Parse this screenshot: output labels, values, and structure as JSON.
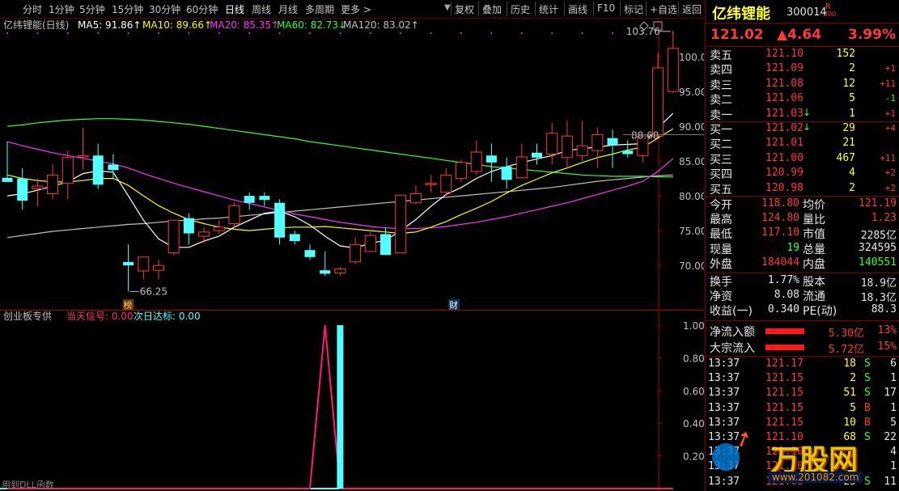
{
  "toolbar": {
    "periods": [
      "分时",
      "1分钟",
      "5分钟",
      "15分钟",
      "30分钟",
      "60分钟",
      "日线",
      "周线",
      "月线",
      "多周期",
      "更多 >"
    ],
    "actions": [
      "复权",
      "叠加",
      "历史",
      "统计",
      "画线",
      "F10",
      "标记",
      "+自选",
      "返回"
    ],
    "top_glyph": "▼"
  },
  "chart_header": {
    "name": "亿纬锂能(日线)",
    "ma5": "MA5: 91.86↑",
    "ma10": "MA10: 89.66↑",
    "ma20": "MA20: 85.35↑",
    "ma60": "MA60: 82.73↓",
    "ma120": "MA120: 83.02↑"
  },
  "colors": {
    "up": "#ff3a3a",
    "down": "#54ffff",
    "ma5": "#ffffff",
    "ma10": "#ffff00",
    "ma20": "#ff33ff",
    "ma60": "#33ff33",
    "ma120": "#c0c0c0",
    "axis": "#b00000"
  },
  "main_axis": {
    "ticks": [
      "100.0",
      "95.00",
      "90.00",
      "85.00",
      "80.00",
      "75.00",
      "70.00"
    ],
    "tick_values": [
      100,
      95,
      90,
      85,
      80,
      75,
      70
    ],
    "ylim": [
      63.5,
      105.6
    ]
  },
  "annotations": {
    "high_label": "103.76",
    "low_label": "66.25",
    "current_price_tag": "88.68",
    "bang_tag": "榜",
    "cai_tag": "财"
  },
  "chart_data": [
    {
      "type": "candlestick",
      "candles": [
        {
          "o": 82.6,
          "h": 87.8,
          "l": 82.3,
          "c": 82.0
        },
        {
          "o": 82.5,
          "h": 84.0,
          "l": 78.0,
          "c": 79.3
        },
        {
          "o": 81.0,
          "h": 82.5,
          "l": 78.5,
          "c": 81.4
        },
        {
          "o": 80.3,
          "h": 84.5,
          "l": 79.5,
          "c": 83.0
        },
        {
          "o": 81.8,
          "h": 86.5,
          "l": 79.5,
          "c": 85.5
        },
        {
          "o": 85.6,
          "h": 89.8,
          "l": 83.8,
          "c": 85.8
        },
        {
          "o": 85.8,
          "h": 87.5,
          "l": 81.0,
          "c": 81.6
        },
        {
          "o": 84.5,
          "h": 86.0,
          "l": 82.5,
          "c": 83.7
        },
        {
          "o": 70.5,
          "h": 73.0,
          "l": 66.25,
          "c": 70.0
        },
        {
          "o": 69.2,
          "h": 71.0,
          "l": 68.0,
          "c": 71.2
        },
        {
          "o": 69.3,
          "h": 70.8,
          "l": 68.0,
          "c": 70.0
        },
        {
          "o": 71.8,
          "h": 75.5,
          "l": 71.5,
          "c": 76.5
        },
        {
          "o": 76.8,
          "h": 77.5,
          "l": 73.0,
          "c": 74.6
        },
        {
          "o": 74.2,
          "h": 75.5,
          "l": 73.2,
          "c": 74.8
        },
        {
          "o": 75.0,
          "h": 76.5,
          "l": 74.5,
          "c": 75.5
        },
        {
          "o": 76.0,
          "h": 79.0,
          "l": 75.5,
          "c": 78.6
        },
        {
          "o": 80.0,
          "h": 80.5,
          "l": 78.0,
          "c": 79.0
        },
        {
          "o": 80.0,
          "h": 80.5,
          "l": 78.5,
          "c": 79.4
        },
        {
          "o": 79.0,
          "h": 79.5,
          "l": 73.0,
          "c": 74.0
        },
        {
          "o": 74.5,
          "h": 75.0,
          "l": 73.0,
          "c": 73.5
        },
        {
          "o": 72.2,
          "h": 73.0,
          "l": 70.8,
          "c": 71.2
        },
        {
          "o": 69.3,
          "h": 72.0,
          "l": 68.5,
          "c": 68.8
        },
        {
          "o": 68.9,
          "h": 69.8,
          "l": 68.5,
          "c": 69.5
        },
        {
          "o": 70.5,
          "h": 74.0,
          "l": 70.2,
          "c": 73.0
        },
        {
          "o": 72.0,
          "h": 74.8,
          "l": 72.2,
          "c": 74.3
        },
        {
          "o": 74.5,
          "h": 75.5,
          "l": 71.5,
          "c": 71.5
        },
        {
          "o": 71.8,
          "h": 80.0,
          "l": 71.8,
          "c": 80.1
        },
        {
          "o": 79.0,
          "h": 81.5,
          "l": 78.8,
          "c": 80.3
        },
        {
          "o": 81.6,
          "h": 83.0,
          "l": 80.5,
          "c": 81.8
        },
        {
          "o": 80.5,
          "h": 84.0,
          "l": 80.0,
          "c": 83.0
        },
        {
          "o": 82.5,
          "h": 85.2,
          "l": 82.0,
          "c": 84.8
        },
        {
          "o": 83.5,
          "h": 88.0,
          "l": 83.0,
          "c": 86.3
        },
        {
          "o": 85.8,
          "h": 87.5,
          "l": 82.0,
          "c": 84.8
        },
        {
          "o": 84.2,
          "h": 85.5,
          "l": 81.0,
          "c": 82.3
        },
        {
          "o": 82.6,
          "h": 87.5,
          "l": 82.5,
          "c": 85.6
        },
        {
          "o": 86.2,
          "h": 87.5,
          "l": 84.5,
          "c": 85.5
        },
        {
          "o": 86.0,
          "h": 90.5,
          "l": 84.5,
          "c": 89.0
        },
        {
          "o": 85.5,
          "h": 90.8,
          "l": 84.0,
          "c": 88.6
        },
        {
          "o": 85.8,
          "h": 90.8,
          "l": 85.0,
          "c": 87.2
        },
        {
          "o": 86.5,
          "h": 89.8,
          "l": 84.0,
          "c": 88.8
        },
        {
          "o": 88.3,
          "h": 89.5,
          "l": 84.0,
          "c": 87.3
        },
        {
          "o": 86.5,
          "h": 88.0,
          "l": 85.5,
          "c": 86.0
        },
        {
          "o": 85.8,
          "h": 88.5,
          "l": 84.8,
          "c": 88.6
        },
        {
          "o": 88.6,
          "h": 100.5,
          "l": 88.5,
          "c": 98.4
        },
        {
          "o": 95.0,
          "h": 103.76,
          "l": 94.8,
          "c": 101.2
        }
      ],
      "ma5": [
        80.0,
        80.3,
        80.8,
        81.4,
        82.0,
        83.2,
        83.6,
        83.4,
        80.0,
        76.5,
        73.8,
        72.6,
        72.6,
        73.5,
        74.2,
        75.5,
        76.5,
        77.5,
        77.8,
        77.0,
        75.8,
        74.2,
        72.8,
        72.5,
        73.2,
        73.6,
        75.0,
        76.6,
        78.5,
        80.2,
        81.2,
        82.5,
        83.5,
        84.2,
        84.8,
        85.3,
        85.8,
        86.5,
        86.8,
        87.0,
        87.3,
        87.4,
        87.5,
        89.8,
        91.86
      ],
      "ma10": [
        83.0,
        82.5,
        82.2,
        82.0,
        82.0,
        82.2,
        82.5,
        82.5,
        81.5,
        80.0,
        78.6,
        77.5,
        76.6,
        76.0,
        75.5,
        75.2,
        75.0,
        75.2,
        75.4,
        75.5,
        75.5,
        75.6,
        75.4,
        75.2,
        75.0,
        74.8,
        74.6,
        74.8,
        75.5,
        76.3,
        77.3,
        78.2,
        79.2,
        80.4,
        81.5,
        82.4,
        83.3,
        84.0,
        84.8,
        85.5,
        86.0,
        86.6,
        87.0,
        88.3,
        89.66
      ],
      "ma20": [
        87.8,
        87.2,
        86.7,
        86.2,
        85.8,
        85.4,
        85.0,
        84.6,
        84.0,
        83.2,
        82.5,
        81.8,
        81.2,
        80.6,
        80.0,
        79.4,
        78.9,
        78.4,
        77.9,
        77.4,
        77.0,
        76.6,
        76.2,
        75.9,
        75.6,
        75.4,
        75.3,
        75.3,
        75.4,
        75.6,
        75.9,
        76.2,
        76.6,
        77.0,
        77.5,
        78.0,
        78.5,
        79.0,
        79.6,
        80.2,
        80.8,
        81.4,
        82.1,
        83.5,
        85.35
      ],
      "ma60": [
        90.0,
        90.2,
        90.5,
        90.7,
        90.9,
        91.0,
        91.1,
        91.1,
        91.0,
        90.9,
        90.7,
        90.5,
        90.3,
        90.0,
        89.7,
        89.4,
        89.1,
        88.8,
        88.5,
        88.2,
        87.8,
        87.5,
        87.2,
        86.9,
        86.6,
        86.3,
        86.0,
        85.7,
        85.4,
        85.1,
        84.8,
        84.5,
        84.2,
        84.0,
        83.8,
        83.6,
        83.4,
        83.2,
        83.0,
        82.9,
        82.8,
        82.8,
        82.8,
        82.75,
        82.73
      ],
      "ma120": [
        74.0,
        74.3,
        74.6,
        74.9,
        75.1,
        75.3,
        75.5,
        75.7,
        75.9,
        76.0,
        76.2,
        76.4,
        76.5,
        76.7,
        76.8,
        77.0,
        77.2,
        77.4,
        77.6,
        77.8,
        78.0,
        78.2,
        78.4,
        78.6,
        78.8,
        79.0,
        79.2,
        79.4,
        79.6,
        79.8,
        80.0,
        80.2,
        80.4,
        80.6,
        80.8,
        81.0,
        81.2,
        81.5,
        81.8,
        82.1,
        82.3,
        82.5,
        82.7,
        82.9,
        83.02
      ]
    },
    {
      "type": "line",
      "title": "创业板专供",
      "series": [
        {
          "name": "当天信号",
          "values_note": "pulse",
          "values": [
            0,
            0,
            0,
            0,
            0,
            0,
            0,
            0,
            0,
            0,
            0,
            0,
            0,
            0,
            0,
            0,
            0,
            0,
            0,
            0,
            0,
            1,
            0,
            0,
            0,
            0,
            0,
            0,
            0,
            0,
            0,
            0,
            0,
            0,
            0,
            0,
            0,
            0,
            0,
            0,
            0,
            0,
            0,
            0,
            0
          ]
        },
        {
          "name": "次日达标",
          "values": [
            0,
            0,
            0,
            0,
            0,
            0,
            0,
            0,
            0,
            0,
            0,
            0,
            0,
            0,
            0,
            0,
            0,
            0,
            0,
            0,
            0,
            0,
            1,
            0,
            0,
            0,
            0,
            0,
            0,
            0,
            0,
            0,
            0,
            0,
            0,
            0,
            0,
            0,
            0,
            0,
            0,
            0,
            0,
            0,
            0
          ]
        }
      ],
      "ylim": [
        0,
        1.05
      ]
    }
  ],
  "indicator": {
    "name": "创业板专供",
    "signal_label": "当天信号: 0.00",
    "target_label": "次日达标: 0.00",
    "ticks": [
      "1.00",
      "0.80",
      "0.60",
      "0.40",
      "0.20"
    ],
    "tick_values": [
      1.0,
      0.8,
      0.6,
      0.4,
      0.2
    ],
    "footer": "用到DLL函数"
  },
  "stock": {
    "name": "亿纬锂能",
    "code": "300014",
    "r_badge": "R",
    "r_sub": "300",
    "price": "121.02",
    "change": "▲4.64",
    "change_pct": "3.99%"
  },
  "order_book": {
    "asks": [
      {
        "label": "卖五",
        "price": "121.10",
        "vol": "152",
        "chg": ""
      },
      {
        "label": "卖四",
        "price": "121.09",
        "vol": "2",
        "chg": "+1"
      },
      {
        "label": "卖三",
        "price": "121.08",
        "vol": "12",
        "chg": "+11"
      },
      {
        "label": "卖二",
        "price": "121.06",
        "vol": "5",
        "chg": "-1"
      },
      {
        "label": "卖一",
        "price": "121.03",
        "vol": "1",
        "chg": "+1",
        "arrow": "↓"
      }
    ],
    "bids": [
      {
        "label": "买一",
        "price": "121.02",
        "vol": "29",
        "chg": "+4",
        "arrow": "↓"
      },
      {
        "label": "买二",
        "price": "121.01",
        "vol": "21",
        "chg": ""
      },
      {
        "label": "买三",
        "price": "121.00",
        "vol": "467",
        "chg": "+11"
      },
      {
        "label": "买四",
        "price": "120.99",
        "vol": "4",
        "chg": "+2"
      },
      {
        "label": "买五",
        "price": "120.98",
        "vol": "2",
        "chg": "+2"
      }
    ]
  },
  "quote": [
    {
      "l1": "今开",
      "v1": "118.80",
      "l2": "均价",
      "v2": "121.19"
    },
    {
      "l1": "最高",
      "v1": "124.80",
      "l2": "量比",
      "v2": "1.23"
    },
    {
      "l1": "最低",
      "v1": "117.10",
      "l2": "市值",
      "v2": "2285亿"
    },
    {
      "l1": "现量",
      "v1": "19",
      "l2": "总量",
      "v2": "324595"
    },
    {
      "l1": "外盘",
      "v1": "184044",
      "l2": "内盘",
      "v2": "140551"
    }
  ],
  "quote2": [
    {
      "l1": "换手",
      "v1": "1.77%",
      "l2": "股本",
      "v2": "18.9亿"
    },
    {
      "l1": "净资",
      "v1": "8.08",
      "l2": "流通",
      "v2": "18.3亿"
    },
    {
      "l1": "收益(一)",
      "v1": "0.340",
      "l2": "PE(动)",
      "v2": "88.3"
    }
  ],
  "flow": [
    {
      "label": "净流入额",
      "value": "5.30亿",
      "pct": "13%",
      "bar": 0.13
    },
    {
      "label": "大宗流入",
      "value": "5.72亿",
      "pct": "15%",
      "bar": 0.15
    }
  ],
  "ticks": [
    {
      "time": "13:37",
      "price": "121.17",
      "vol": "18",
      "side": "S",
      "n": "6"
    },
    {
      "time": "13:37",
      "price": "121.15",
      "vol": "2",
      "side": "S",
      "n": "1"
    },
    {
      "time": "13:37",
      "price": "121.15",
      "vol": "51",
      "side": "S",
      "n": "17"
    },
    {
      "time": "13:37",
      "price": "121.15",
      "vol": "5",
      "side": "B",
      "n": "1"
    },
    {
      "time": "13:37",
      "price": "121.15",
      "vol": "10",
      "side": "B",
      "n": "5"
    },
    {
      "time": "13:37",
      "price": "121.10",
      "vol": "68",
      "side": "S",
      "n": "22"
    },
    {
      "time": "13:37",
      "price": "121.10",
      "vol": "",
      "side": "",
      "n": "4"
    },
    {
      "time": "13:37",
      "price": "121.10",
      "vol": "",
      "side": "",
      "n": "1"
    },
    {
      "time": "13:37",
      "price": "121.05",
      "vol": "25",
      "side": "S",
      "n": "11"
    }
  ],
  "watermark": {
    "text": "万股网",
    "url": "www.201082.com"
  }
}
